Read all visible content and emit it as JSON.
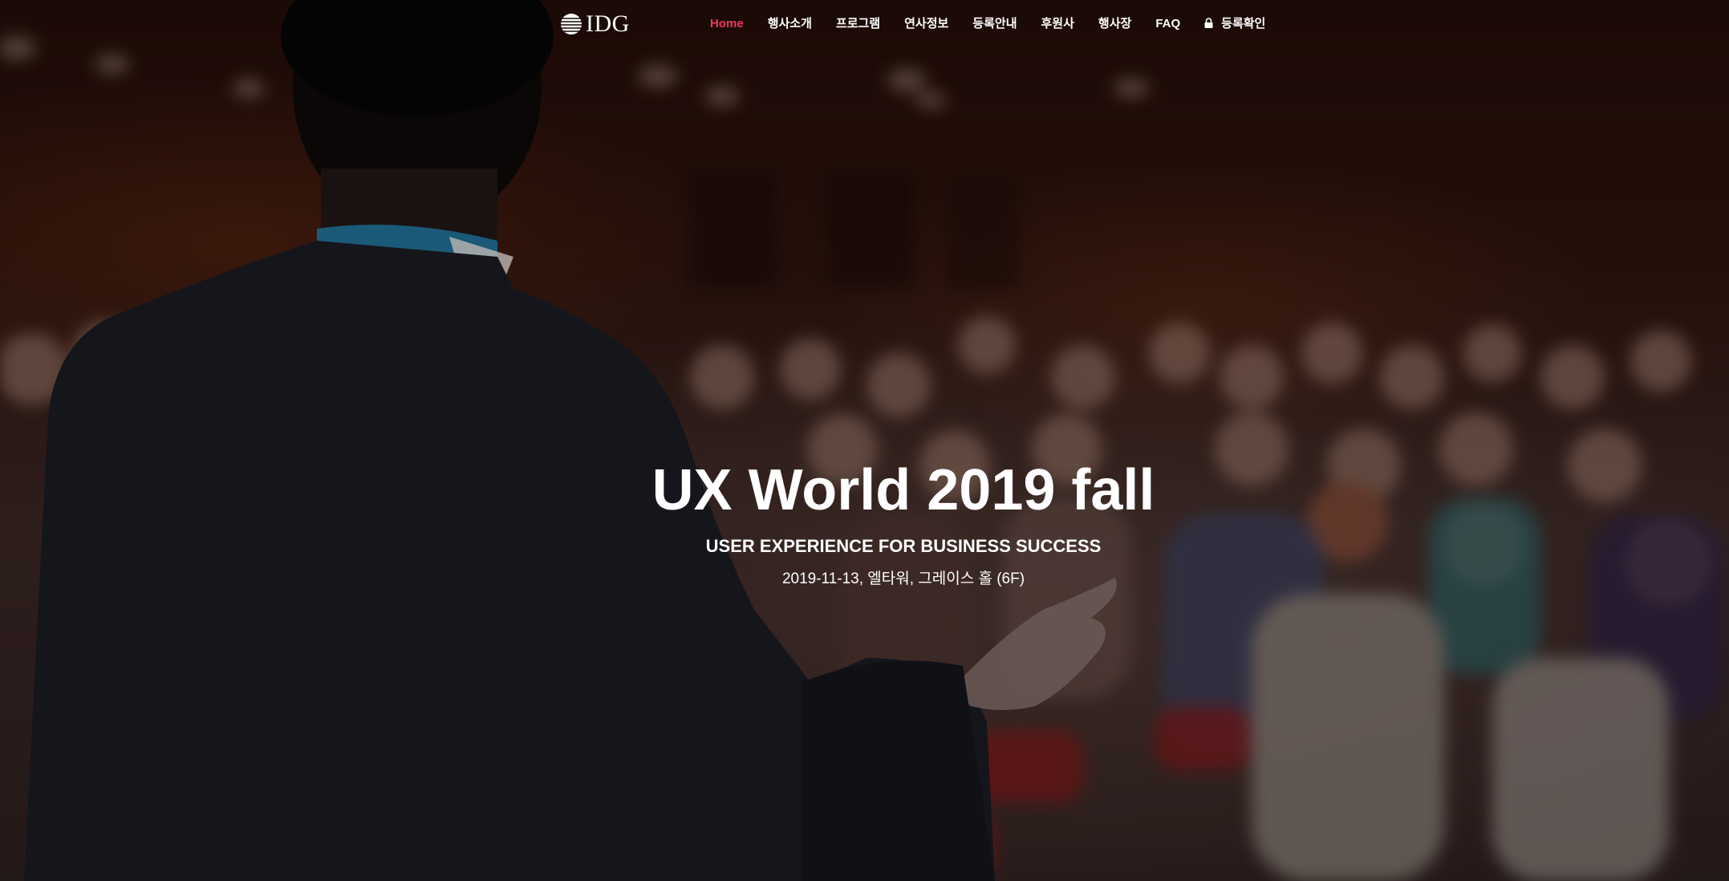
{
  "nav": {
    "logo_text": "IDG",
    "items": [
      {
        "label": "Home",
        "active": true
      },
      {
        "label": "행사소개"
      },
      {
        "label": "프로그램"
      },
      {
        "label": "연사정보"
      },
      {
        "label": "등록안내"
      },
      {
        "label": "후원사"
      },
      {
        "label": "행사장"
      },
      {
        "label": "FAQ"
      },
      {
        "label": "등록확인",
        "icon": "lock-icon"
      }
    ]
  },
  "hero": {
    "title": "UX World 2019 fall",
    "subtitle": "USER EXPERIENCE FOR BUSINESS SUCCESS",
    "meta": "2019-11-13, 엘타워, 그레이스 홀 (6F)",
    "background": "conference-audience-photo"
  },
  "colors": {
    "active_nav": "#e83a58",
    "text": "#ffffff"
  }
}
